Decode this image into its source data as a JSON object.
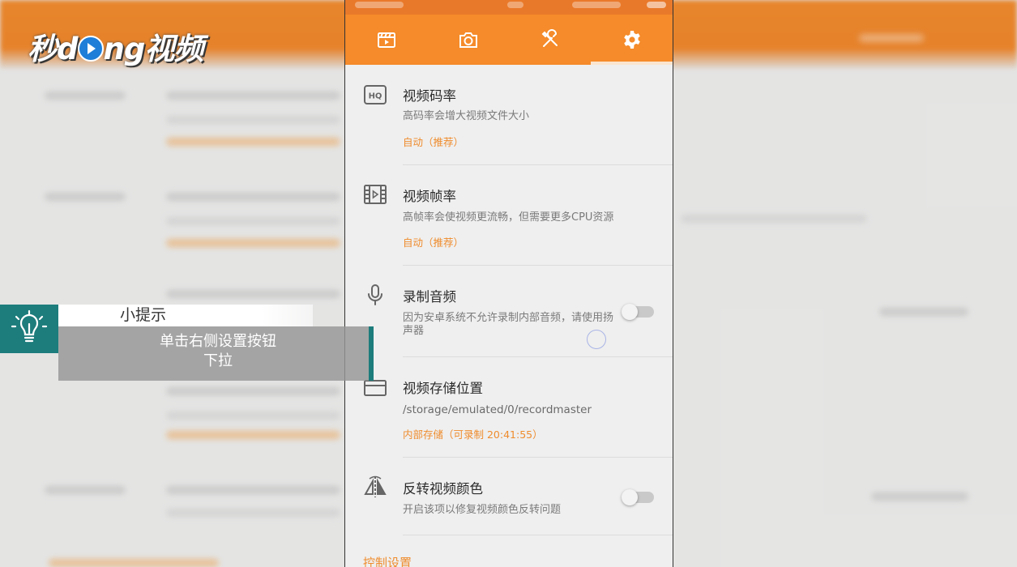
{
  "brand": {
    "logo_text_1": "秒d",
    "logo_text_2": "ng视频"
  },
  "tabs": [
    {
      "icon": "video-clapper-icon",
      "active": false
    },
    {
      "icon": "camera-icon",
      "active": false
    },
    {
      "icon": "tools-icon",
      "active": false
    },
    {
      "icon": "gear-icon",
      "active": true
    }
  ],
  "settings": [
    {
      "icon": "hq-icon",
      "title": "视频码率",
      "desc": "高码率会增大视频文件大小",
      "value": "自动（推荐）"
    },
    {
      "icon": "film-icon",
      "title": "视频帧率",
      "desc": "高帧率会使视频更流畅，但需要更多CPU资源",
      "value": "自动（推荐）"
    },
    {
      "icon": "microphone-icon",
      "title": "录制音频",
      "desc": "因为安卓系统不允许录制内部音频，请使用扬声器",
      "toggle": false
    },
    {
      "icon": "storage-icon",
      "title": "视频存储位置",
      "path": "/storage/emulated/0/recordmaster",
      "value": "内部存储（可录制 20:41:55）"
    },
    {
      "icon": "flip-icon",
      "title": "反转视频颜色",
      "desc": "开启该项以修复视频颜色反转问题",
      "toggle": false
    }
  ],
  "section_header": "控制设置",
  "tip": {
    "title": "小提示",
    "line1": "单击右侧设置按钮",
    "line2": "下拉"
  },
  "colors": {
    "accent": "#f58b2a",
    "teal": "#1d7c7c",
    "value_orange": "#ef8c2d"
  }
}
